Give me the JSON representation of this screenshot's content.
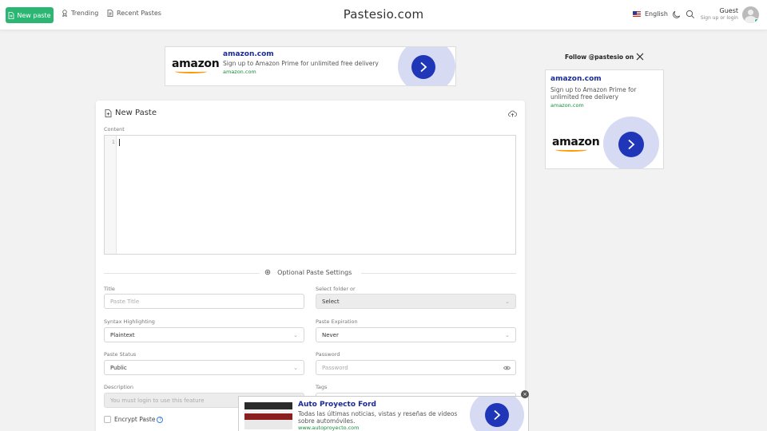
{
  "header": {
    "new_paste_label": "New paste",
    "trending_label": "Trending",
    "recent_label": "Recent Pastes",
    "brand": "Pastesio.com",
    "language": "English",
    "user_name": "Guest",
    "user_sub": "Sign up or login"
  },
  "ads": {
    "top": {
      "logo": "amazon",
      "title": "amazon.com",
      "text": "Sign up to Amazon Prime for unlimited free delivery",
      "url": "amazon.com"
    },
    "side": {
      "title": "amazon.com",
      "text": "Sign up to Amazon Prime for unlimited free delivery",
      "url": "amazon.com",
      "logo": "amazon"
    },
    "bottom": {
      "title": "Auto Proyecto Ford",
      "text": "Todas las últimas noticias, vistas y reseñas de videos sobre automóviles.",
      "url": "www.autoproyecto.com"
    },
    "accent_color": "#1f36b8"
  },
  "follow": {
    "label": "Follow @pastesio on",
    "network_icon": "x-logo-icon"
  },
  "paste": {
    "title": "New Paste",
    "content_label": "Content",
    "line_number": "1",
    "optional_settings_label": "Optional Paste Settings",
    "title_label": "Title",
    "title_placeholder": "Paste Title",
    "folder_label": "Select folder or",
    "folder_value": "Select",
    "syntax_label": "Syntax Highlighting",
    "syntax_value": "Plaintext",
    "expiration_label": "Paste Expiration",
    "expiration_value": "Never",
    "status_label": "Paste Status",
    "status_value": "Public",
    "password_label": "Password",
    "password_placeholder": "Password",
    "description_label": "Description",
    "description_placeholder": "You must login to use this feature",
    "tags_label": "Tags",
    "encrypt_label": "Encrypt Paste"
  },
  "colors": {
    "primary_green": "#2bb673",
    "brand_blue": "#1f36b8"
  }
}
